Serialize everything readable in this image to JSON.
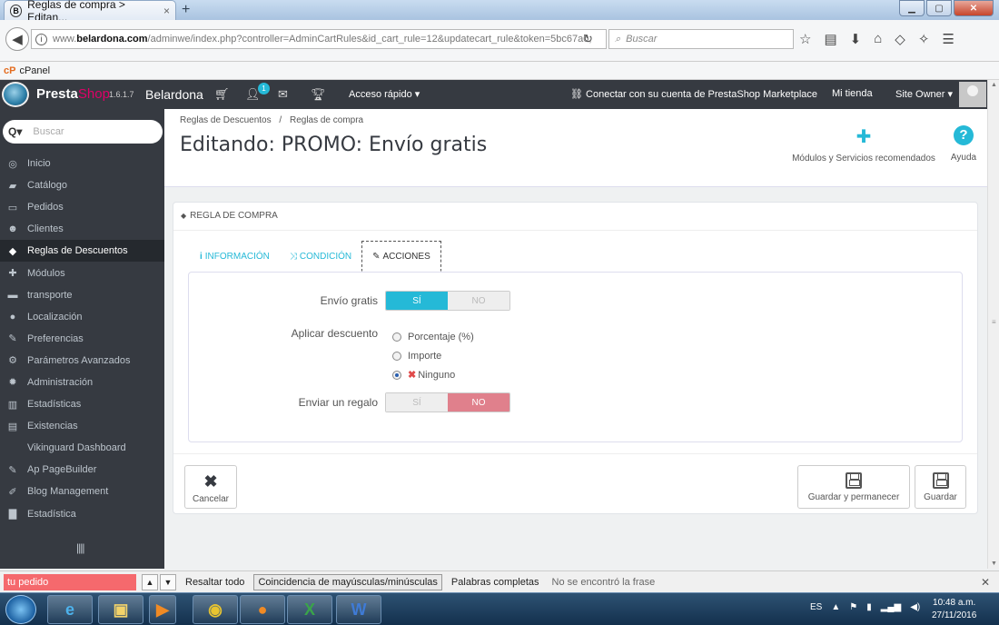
{
  "browser": {
    "tab_title": "Reglas de compra > Editan...",
    "tab_close": "×",
    "new_tab": "+",
    "url_prefix": "www.",
    "url_domain": "belardona.com",
    "url_path": "/adminwe/index.php?controller=AdminCartRules&id_cart_rule=12&updatecart_rule&token=5bc67a0;",
    "search_placeholder": "Buscar",
    "bookmark": "cPanel"
  },
  "header": {
    "brand_presta": "Presta",
    "brand_shop": "Shop",
    "version": "1.6.1.7",
    "store": "Belardona",
    "notifications": "1",
    "quick_access": "Acceso rápido ▾",
    "connect": "Conectar con su cuenta de PrestaShop Marketplace",
    "my_shop": "Mi tienda",
    "owner": "Site Owner ▾"
  },
  "sidebar": {
    "search_placeholder": "Buscar",
    "items": [
      {
        "label": "Inicio",
        "icon": "dashboard-icon",
        "glyph": "◎"
      },
      {
        "label": "Catálogo",
        "icon": "book-icon",
        "glyph": "▰"
      },
      {
        "label": "Pedidos",
        "icon": "credit-card-icon",
        "glyph": "▭"
      },
      {
        "label": "Clientes",
        "icon": "users-icon",
        "glyph": "☻"
      },
      {
        "label": "Reglas de Descuentos",
        "icon": "tag-icon",
        "glyph": "◆"
      },
      {
        "label": "Módulos",
        "icon": "puzzle-icon",
        "glyph": "✚"
      },
      {
        "label": "transporte",
        "icon": "truck-icon",
        "glyph": "▬"
      },
      {
        "label": "Localización",
        "icon": "globe-icon",
        "glyph": "●"
      },
      {
        "label": "Preferencias",
        "icon": "wrench-icon",
        "glyph": "✎"
      },
      {
        "label": "Parámetros Avanzados",
        "icon": "cogs-icon",
        "glyph": "⚙"
      },
      {
        "label": "Administración",
        "icon": "cog-icon",
        "glyph": "✹"
      },
      {
        "label": "Estadísticas",
        "icon": "bar-chart-icon",
        "glyph": "▥"
      },
      {
        "label": "Existencias",
        "icon": "archive-icon",
        "glyph": "▤"
      },
      {
        "label": "Vikinguard Dashboard",
        "icon": "",
        "glyph": ""
      },
      {
        "label": "Ap PageBuilder",
        "icon": "edit-icon",
        "glyph": "✎"
      },
      {
        "label": "Blog Management",
        "icon": "pencil-icon",
        "glyph": "✐"
      },
      {
        "label": "Estadística",
        "icon": "stats-icon",
        "glyph": "▇"
      }
    ],
    "collapse": "||||"
  },
  "page": {
    "breadcrumb_1": "Reglas de Descuentos",
    "breadcrumb_sep": "/",
    "breadcrumb_2": "Reglas de compra",
    "title": "Editando: PROMO: Envío gratis",
    "toolbar_modules": "Módulos y Servicios recomendados",
    "toolbar_help": "Ayuda"
  },
  "panel": {
    "heading": "Regla de compra",
    "tabs": [
      {
        "label": "INFORMACIÓN",
        "icon": "i"
      },
      {
        "label": "CONDICIÓN",
        "icon": "⤨"
      },
      {
        "label": "ACCIONES",
        "icon": "✎"
      }
    ],
    "free_shipping": {
      "label": "Envío gratis",
      "yes": "SÍ",
      "no": "NO",
      "value": "SÍ"
    },
    "apply_discount": {
      "label": "Aplicar descuento",
      "options": [
        "Porcentaje (%)",
        "Importe",
        "Ninguno"
      ],
      "selected": "Ninguno"
    },
    "send_gift": {
      "label": "Enviar un regalo",
      "yes": "SÍ",
      "no": "NO",
      "value": "NO"
    },
    "cancel": "Cancelar",
    "save_stay": "Guardar y permanecer",
    "save": "Guardar"
  },
  "findbar": {
    "query": "tu pedido",
    "highlight_all": "Resaltar todo",
    "match_case": "Coincidencia de mayúsculas/minúsculas",
    "whole_words": "Palabras completas",
    "status": "No se encontró la frase"
  },
  "taskbar": {
    "lang": "ES",
    "time": "10:48 a.m.",
    "date": "27/11/2016"
  },
  "colors": {
    "accent": "#25b9d7",
    "brand_pink": "#df0067",
    "header_bg": "#363a41",
    "no_active": "#e0808c"
  }
}
